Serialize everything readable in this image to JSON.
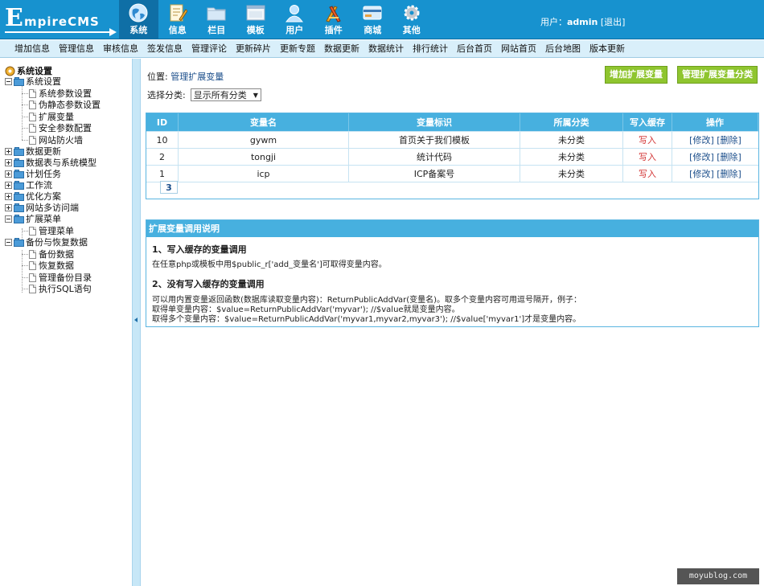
{
  "header": {
    "logo_big": "E",
    "logo_rest": "mpireCMS",
    "tabs": [
      {
        "label": "系统",
        "icon": "globe-icon"
      },
      {
        "label": "信息",
        "icon": "edit-icon"
      },
      {
        "label": "栏目",
        "icon": "folder-icon"
      },
      {
        "label": "模板",
        "icon": "window-icon"
      },
      {
        "label": "用户",
        "icon": "user-icon"
      },
      {
        "label": "插件",
        "icon": "tools-icon"
      },
      {
        "label": "商城",
        "icon": "card-icon"
      },
      {
        "label": "其他",
        "icon": "gear-icon"
      }
    ],
    "user_prefix": "用户：",
    "username": "admin",
    "logout": "[退出]"
  },
  "subnav": [
    "增加信息",
    "管理信息",
    "审核信息",
    "签发信息",
    "管理评论",
    "更新碎片",
    "更新专题",
    "数据更新",
    "数据统计",
    "排行统计",
    "后台首页",
    "网站首页",
    "后台地图",
    "版本更新"
  ],
  "sidebar": {
    "root": "系统设置",
    "items": [
      {
        "label": "系统设置"
      },
      {
        "label": "系统参数设置"
      },
      {
        "label": "伪静态参数设置"
      },
      {
        "label": "扩展变量"
      },
      {
        "label": "安全参数配置"
      },
      {
        "label": "网站防火墙"
      },
      {
        "label": "数据更新"
      },
      {
        "label": "数据表与系统模型"
      },
      {
        "label": "计划任务"
      },
      {
        "label": "工作流"
      },
      {
        "label": "优化方案"
      },
      {
        "label": "网站多访问端"
      },
      {
        "label": "扩展菜单"
      },
      {
        "label": "管理菜单"
      },
      {
        "label": "备份与恢复数据"
      },
      {
        "label": "备份数据"
      },
      {
        "label": "恢复数据"
      },
      {
        "label": "管理备份目录"
      },
      {
        "label": "执行SQL语句"
      }
    ]
  },
  "main": {
    "location_prefix": "位置: ",
    "location_link": "管理扩展变量",
    "btn_add": "增加扩展变量",
    "btn_manage_class": "管理扩展变量分类",
    "filter_label": "选择分类:",
    "filter_value": "显示所有分类",
    "columns": [
      "ID",
      "变量名",
      "变量标识",
      "所属分类",
      "写入缓存",
      "操作"
    ],
    "rows": [
      {
        "id": "10",
        "name": "gywm",
        "mark": "首页关于我们模板",
        "cat": "未分类",
        "cache": "写入",
        "edit": "[修改]",
        "del": "[删除]"
      },
      {
        "id": "2",
        "name": "tongji",
        "mark": "统计代码",
        "cat": "未分类",
        "cache": "写入",
        "edit": "[修改]",
        "del": "[删除]"
      },
      {
        "id": "1",
        "name": "icp",
        "mark": "ICP备案号",
        "cat": "未分类",
        "cache": "写入",
        "edit": "[修改]",
        "del": "[删除]"
      }
    ],
    "pager": "3"
  },
  "help": {
    "title": "扩展变量调用说明",
    "h1": "1、写入缓存的变量调用",
    "p1": "在任意php或模板中用$public_r['add_变量名']可取得变量内容。",
    "h2": "2、没有写入缓存的变量调用",
    "p2": "可以用内置变量返回函数(数据库读取变量内容)：ReturnPublicAddVar(变量名)。取多个变量内容可用逗号隔开，例子：",
    "p3": "取得单变量内容：$value=ReturnPublicAddVar('myvar'); //$value就是变量内容。",
    "p4": "取得多个变量内容：$value=ReturnPublicAddVar('myvar1,myvar2,myvar3'); //$value['myvar1']才是变量内容。"
  },
  "watermark": "moyublog.com"
}
